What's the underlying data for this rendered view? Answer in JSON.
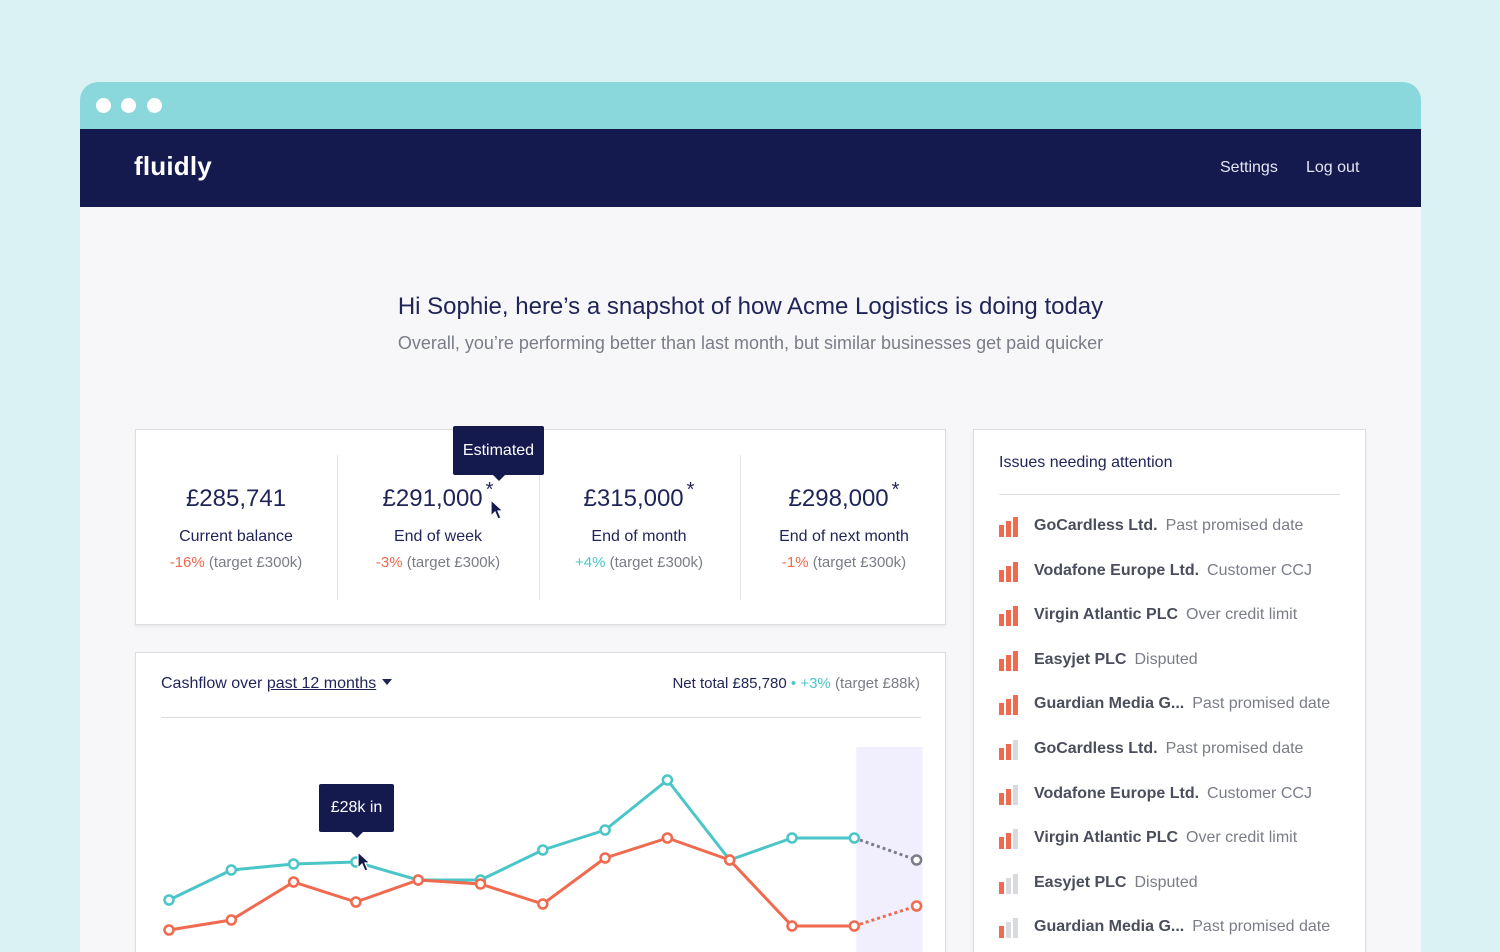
{
  "nav": {
    "logo": "fluidly",
    "links": [
      "Settings",
      "Log out"
    ]
  },
  "greeting": {
    "title": "Hi Sophie, here’s a snapshot of how Acme Logistics is doing today",
    "subtitle": "Overall, you’re performing better than last month, but similar businesses get paid quicker"
  },
  "kpis": [
    {
      "value": "£285,741",
      "estimated": false,
      "label": "Current balance",
      "delta": "-16%",
      "trend": "neg",
      "target": "(target £300k)"
    },
    {
      "value": "£291,000",
      "estimated": true,
      "label": "End of week",
      "delta": "-3%",
      "trend": "neg",
      "target": "(target £300k)"
    },
    {
      "value": "£315,000",
      "estimated": true,
      "label": "End of month",
      "delta": "+4%",
      "trend": "pos",
      "target": "(target £300k)"
    },
    {
      "value": "£298,000",
      "estimated": true,
      "label": "End of next month",
      "delta": "-1%",
      "trend": "neg",
      "target": "(target £300k)"
    }
  ],
  "estimated_tooltip": "Estimated",
  "estimated_marker": "*",
  "issues": {
    "title": "Issues needing attention",
    "items": [
      {
        "company": "GoCardless Ltd.",
        "status": "Past promised date",
        "severity": 3
      },
      {
        "company": "Vodafone Europe Ltd.",
        "status": "Customer CCJ",
        "severity": 3
      },
      {
        "company": "Virgin Atlantic PLC",
        "status": "Over credit limit",
        "severity": 3
      },
      {
        "company": "Easyjet PLC",
        "status": "Disputed",
        "severity": 3
      },
      {
        "company": "Guardian Media G...",
        "status": "Past promised date",
        "severity": 3
      },
      {
        "company": "GoCardless Ltd.",
        "status": "Past promised date",
        "severity": 2
      },
      {
        "company": "Vodafone Europe Ltd.",
        "status": "Customer CCJ",
        "severity": 2
      },
      {
        "company": "Virgin Atlantic PLC",
        "status": "Over credit limit",
        "severity": 2
      },
      {
        "company": "Easyjet PLC",
        "status": "Disputed",
        "severity": 1
      },
      {
        "company": "Guardian Media G...",
        "status": "Past promised date",
        "severity": 1
      }
    ]
  },
  "cashflow": {
    "title_prefix": "Cashflow over",
    "period": "past 12 months",
    "net_label": "Net total £85,780",
    "separator": "•",
    "net_delta": "+3%",
    "net_target": "(target £88k)",
    "point_tooltip": "£28k in"
  },
  "colors": {
    "navy": "#141a4e",
    "teal": "#4bc6c8",
    "coral": "#f06a4f",
    "grey": "#7a7d88",
    "forecast_band": "#f1effe"
  },
  "chart_data": {
    "type": "line",
    "x": [
      1,
      2,
      3,
      4,
      5,
      6,
      7,
      8,
      9,
      10,
      11,
      12,
      13
    ],
    "forecast_from_index": 11,
    "series": [
      {
        "values": [
          20,
          35,
          38,
          39,
          30,
          30,
          45,
          55,
          80,
          40,
          51,
          51,
          40
        ],
        "color": "#4bc6c8",
        "forecast_color": "#7a7d88"
      },
      {
        "values": [
          5,
          10,
          29,
          19,
          30,
          28,
          18,
          41,
          51,
          40,
          7,
          7,
          17
        ],
        "color": "#f06a4f",
        "forecast_color": "#f06a4f"
      }
    ],
    "ylim": [
      0,
      90
    ],
    "highlighted_point": {
      "series_index": 0,
      "x_index": 3
    }
  }
}
